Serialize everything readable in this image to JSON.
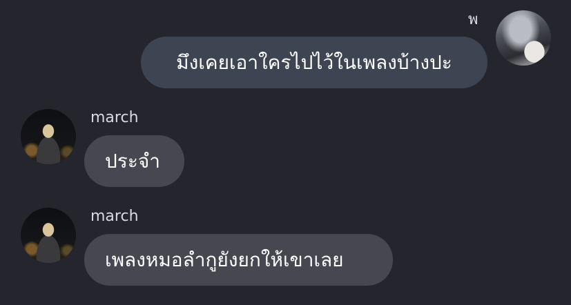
{
  "messages": [
    {
      "sender": "พ",
      "text": "มึงเคยเอาใครไปไว้ในเพลงบ้างปะ",
      "outgoing": true
    },
    {
      "sender": "march",
      "text": "ประจำ",
      "outgoing": false
    },
    {
      "sender": "march",
      "text": "เพลงหมอลำกูยังยกให้เขาเลย",
      "outgoing": false
    }
  ],
  "colors": {
    "background": "#25252d",
    "outgoing_bubble": "#3d4452",
    "incoming_bubble": "#474751",
    "text": "#ffffff",
    "name_text": "#d9d9de"
  }
}
